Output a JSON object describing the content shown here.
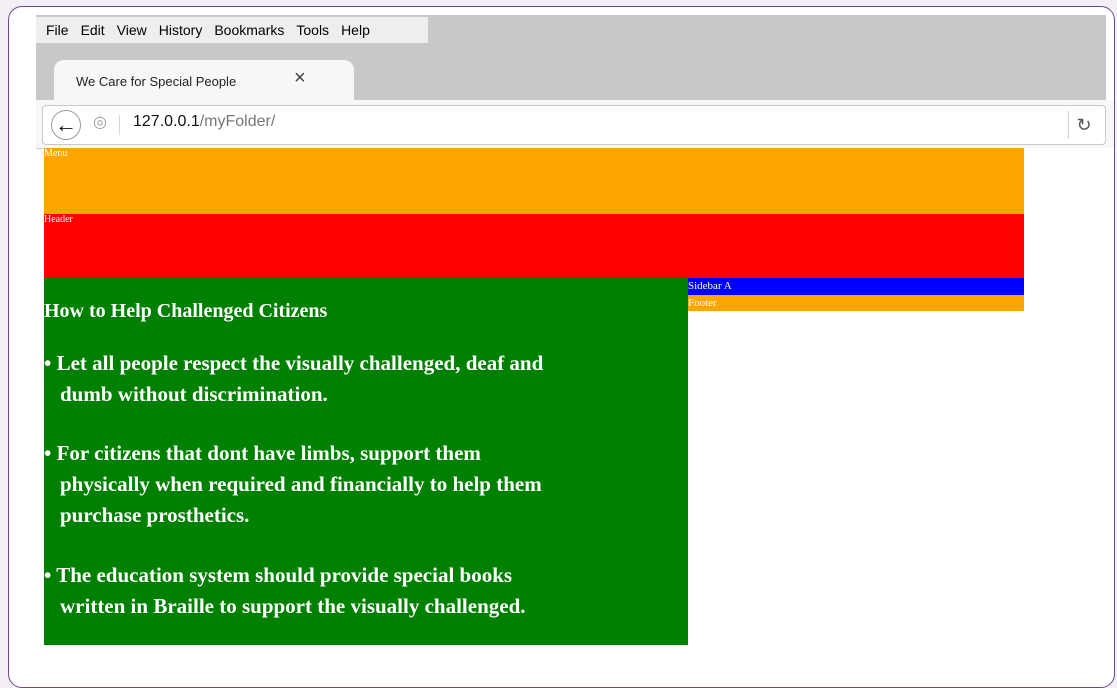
{
  "menubar": {
    "items": [
      "File",
      "Edit",
      "View",
      "History",
      "Bookmarks",
      "Tools",
      "Help"
    ]
  },
  "tab": {
    "title": "We Care for Special People",
    "close_glyph": "×"
  },
  "navbar": {
    "url_host": "127.0.0.1",
    "url_path": "/myFolder/"
  },
  "page": {
    "menu_label": "Menu",
    "header_label": "Header",
    "main": {
      "title": "How to Help Challenged Citizens",
      "points": [
        {
          "line1": "• Let all people respect the visually challenged, deaf and",
          "line2": "dumb without discrimination."
        },
        {
          "line1": "• For citizens that dont have limbs, support them",
          "line2": "physically when required and financially to help them",
          "line3": "purchase prosthetics."
        },
        {
          "line1": "• The education system should provide special books",
          "line2": "written in Braille to support the visually challenged."
        }
      ]
    },
    "sidebar_label": "Sidebar A",
    "footer_label": "Footer"
  },
  "colors": {
    "menu": "#ffa500",
    "header": "#ff0000",
    "main": "#008000",
    "sidebar": "#0000ff",
    "footer": "#ffa500",
    "frame_border": "#6b4a8f"
  }
}
